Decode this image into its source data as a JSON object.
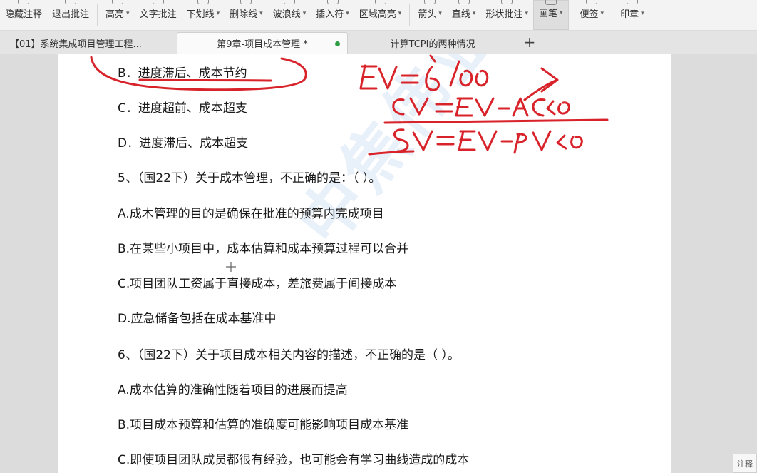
{
  "toolbar": {
    "items": [
      {
        "label": "隐藏注释",
        "icon": "hide-annotation-icon",
        "caret": false
      },
      {
        "label": "退出批注",
        "icon": "exit-annotation-icon",
        "caret": false
      },
      {
        "label": "高亮",
        "icon": "highlight-icon",
        "caret": true
      },
      {
        "label": "文字批注",
        "icon": "text-annotation-icon",
        "caret": false
      },
      {
        "label": "下划线",
        "icon": "underline-icon",
        "caret": true
      },
      {
        "label": "删除线",
        "icon": "strikethrough-icon",
        "caret": true
      },
      {
        "label": "波浪线",
        "icon": "wavy-line-icon",
        "caret": true
      },
      {
        "label": "插入符",
        "icon": "insert-caret-icon",
        "caret": true
      },
      {
        "label": "区域高亮",
        "icon": "area-highlight-icon",
        "caret": true
      },
      {
        "label": "箭头",
        "icon": "arrow-icon",
        "caret": true
      },
      {
        "label": "直线",
        "icon": "line-icon",
        "caret": true
      },
      {
        "label": "形状批注",
        "icon": "shape-annotation-icon",
        "caret": true
      },
      {
        "label": "画笔",
        "icon": "pen-icon",
        "caret": true
      },
      {
        "label": "便签",
        "icon": "sticky-note-icon",
        "caret": true
      },
      {
        "label": "印章",
        "icon": "stamp-icon",
        "caret": true
      }
    ],
    "caret_glyph": "▾"
  },
  "tabs": [
    {
      "label": "【01】系统集成项目管理工程...",
      "active": false
    },
    {
      "label": "第9章-项目成本管理 *",
      "active": true
    },
    {
      "label": "计算TCPI的两种情况",
      "active": false
    }
  ],
  "tab_add": "+",
  "document": {
    "lines": [
      "B．进度滞后、成本节约",
      "C．进度超前、成本超支",
      "D．进度滞后、成本超支",
      "5、（国22下）关于成本管理，不正确的是：（  ）。",
      "A.成木管理的目的是确保在批准的预算内完成项目",
      "B.在某些小项目中，成本估算和成本预算过程可以合并",
      "C.项目团队工资属于直接成本，差旅费属于间接成本",
      "D.应急储备包括在成本基准中",
      "6、（国22下）关于项目成本相关内容的描述，不正确的是（  ）。",
      "A.成本估算的准确性随着项目的进展而提高",
      "B.项目成本预算和估算的准确度可能影响项目成本基准",
      "C.即使项目团队成员都很有经验，也可能会有学习曲线造成的成本"
    ],
    "watermark": "中焦伟业"
  },
  "handwriting": {
    "ink_color": "#d8232a",
    "notes": [
      "EV=6/00",
      "CV=EV-AC<0",
      "SV=EV-PV<0"
    ]
  },
  "side_badge": "注释"
}
